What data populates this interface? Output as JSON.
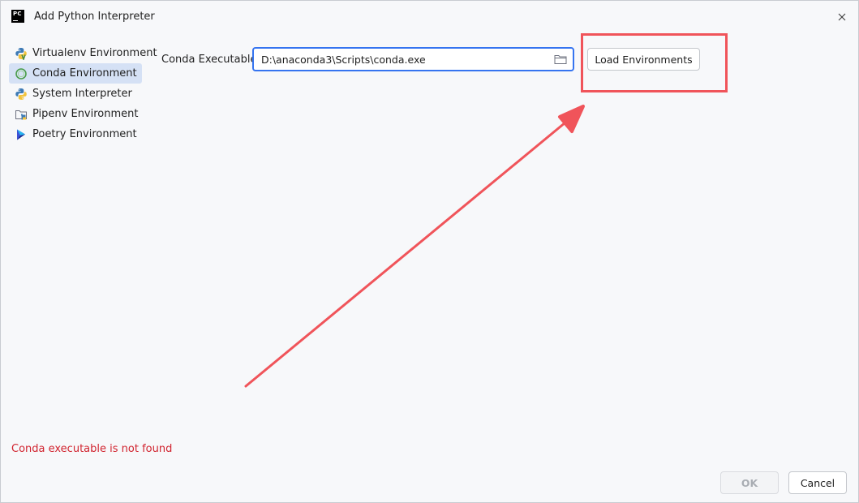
{
  "window": {
    "title": "Add Python Interpreter",
    "logo_text": "PC"
  },
  "sidebar": {
    "items": [
      {
        "label": "Virtualenv Environment",
        "icon": "python-virtualenv-icon",
        "selected": false
      },
      {
        "label": "Conda Environment",
        "icon": "conda-icon",
        "selected": true
      },
      {
        "label": "System Interpreter",
        "icon": "python-icon",
        "selected": false
      },
      {
        "label": "Pipenv Environment",
        "icon": "pipenv-folder-icon",
        "selected": false
      },
      {
        "label": "Poetry Environment",
        "icon": "poetry-icon",
        "selected": false
      }
    ]
  },
  "form": {
    "conda_label": "Conda Executable:",
    "conda_path": "D:\\anaconda3\\Scripts\\conda.exe",
    "load_button": "Load Environments"
  },
  "status": {
    "error": "Conda executable is not found"
  },
  "footer": {
    "ok_label": "OK",
    "cancel_label": "Cancel"
  },
  "colors": {
    "accent": "#3574f0",
    "selection": "#d5e1f5",
    "annotation": "#f0545a",
    "error": "#d1242f"
  }
}
